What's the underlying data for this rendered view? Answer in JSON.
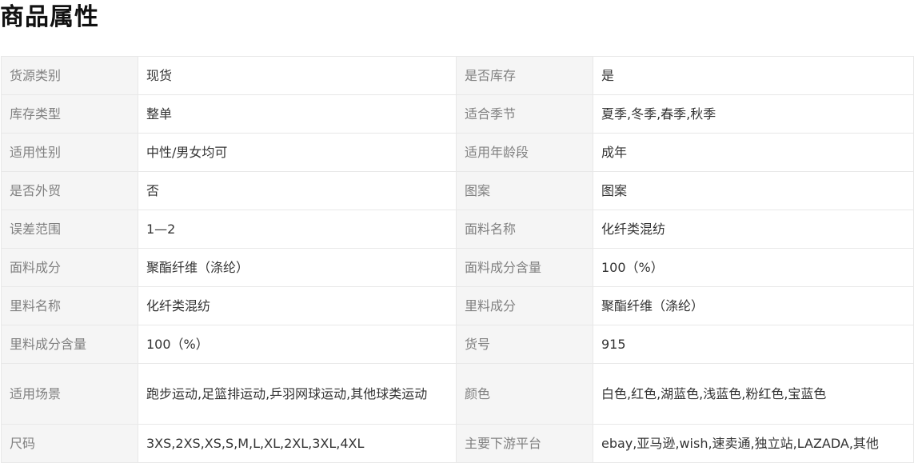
{
  "title": "商品属性",
  "rows": [
    {
      "l1": "货源类别",
      "v1": "现货",
      "l2": "是否库存",
      "v2": "是"
    },
    {
      "l1": "库存类型",
      "v1": "整单",
      "l2": "适合季节",
      "v2": "夏季,冬季,春季,秋季"
    },
    {
      "l1": "适用性别",
      "v1": "中性/男女均可",
      "l2": "适用年龄段",
      "v2": "成年"
    },
    {
      "l1": "是否外贸",
      "v1": "否",
      "l2": "图案",
      "v2": "图案"
    },
    {
      "l1": "误差范围",
      "v1": "1—2",
      "l2": "面料名称",
      "v2": "化纤类混纺"
    },
    {
      "l1": "面料成分",
      "v1": "聚酯纤维（涤纶）",
      "l2": "面料成分含量",
      "v2": "100（%）"
    },
    {
      "l1": "里料名称",
      "v1": "化纤类混纺",
      "l2": "里料成分",
      "v2": "聚酯纤维（涤纶）"
    },
    {
      "l1": "里料成分含量",
      "v1": "100（%）",
      "l2": "货号",
      "v2": "915"
    },
    {
      "l1": "适用场景",
      "v1": "跑步运动,足篮排运动,乒羽网球运动,其他球类运动",
      "l2": "颜色",
      "v2": "白色,红色,湖蓝色,浅蓝色,粉红色,宝蓝色"
    },
    {
      "l1": "尺码",
      "v1": "3XS,2XS,XS,S,M,L,XL,2XL,3XL,4XL",
      "l2": "主要下游平台",
      "v2": "ebay,亚马逊,wish,速卖通,独立站,LAZADA,其他"
    }
  ]
}
